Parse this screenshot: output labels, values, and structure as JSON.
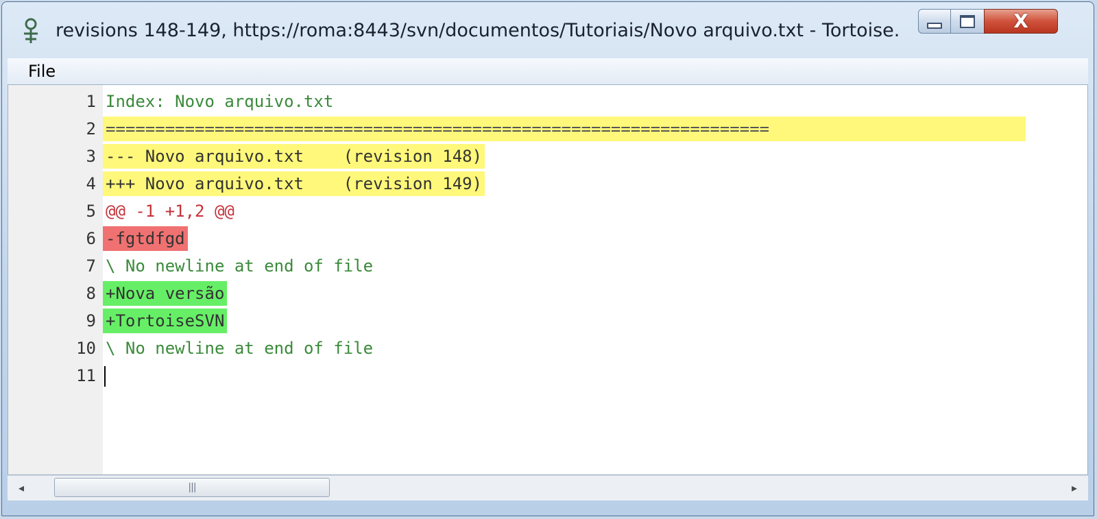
{
  "window": {
    "title": "revisions 148-149, https://roma:8443/svn/documentos/Tutoriais/Novo arquivo.txt - Tortoise...",
    "controls": {
      "minimize": "minimize",
      "maximize": "maximize",
      "close": "X"
    }
  },
  "menu": {
    "file_label": "File"
  },
  "diff": {
    "lines": [
      {
        "n": "1",
        "text": "Index: Novo arquivo.txt"
      },
      {
        "n": "2",
        "text": "==================================================================="
      },
      {
        "n": "3",
        "text": "--- Novo arquivo.txt    (revision 148)"
      },
      {
        "n": "4",
        "text": "+++ Novo arquivo.txt    (revision 149)"
      },
      {
        "n": "5",
        "text": "@@ -1 +1,2 @@"
      },
      {
        "n": "6",
        "text": "-fgtdfgd"
      },
      {
        "n": "7",
        "text": "\\ No newline at end of file"
      },
      {
        "n": "8",
        "text": "+Nova versão"
      },
      {
        "n": "9",
        "text": "+TortoiseSVN"
      },
      {
        "n": "10",
        "text": "\\ No newline at end of file"
      },
      {
        "n": "11",
        "text": ""
      }
    ],
    "colors": {
      "header": "#fff87a",
      "removed": "#f07171",
      "added": "#66ef66",
      "context": "#3a8a3a",
      "hunk": "#c4323a"
    }
  },
  "scrollbar": {
    "left_arrow": "◂",
    "right_arrow": "▸",
    "grip": "|||"
  },
  "icons": {
    "app": "tortoisesvn-icon"
  }
}
